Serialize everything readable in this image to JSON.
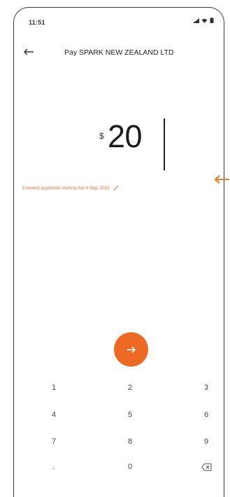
{
  "status_bar": {
    "time": "11:51",
    "icons": [
      "signal-icon",
      "wifi-icon",
      "battery-icon"
    ]
  },
  "header": {
    "back_icon": "back-arrow-icon",
    "title": "Pay SPARK NEW ZEALAND LTD"
  },
  "amount": {
    "currency_symbol": "$",
    "value": "20"
  },
  "schedule": {
    "text": "5 weekly payments starting Sat 4 Sep, 2021",
    "icon": "edit-pencil-icon"
  },
  "next_button": {
    "icon": "arrow-right-icon"
  },
  "keypad": {
    "keys": [
      "1",
      "2",
      "3",
      "4",
      "5",
      "6",
      "7",
      "8",
      "9",
      ".",
      "0"
    ],
    "backspace_icon": "backspace-icon"
  },
  "colors": {
    "accent": "#ec6a24",
    "schedule_text": "#ee6d2e",
    "annotation_arrow": "#ee7a2a"
  },
  "annotation": {
    "icon": "pointer-arrow-icon"
  }
}
